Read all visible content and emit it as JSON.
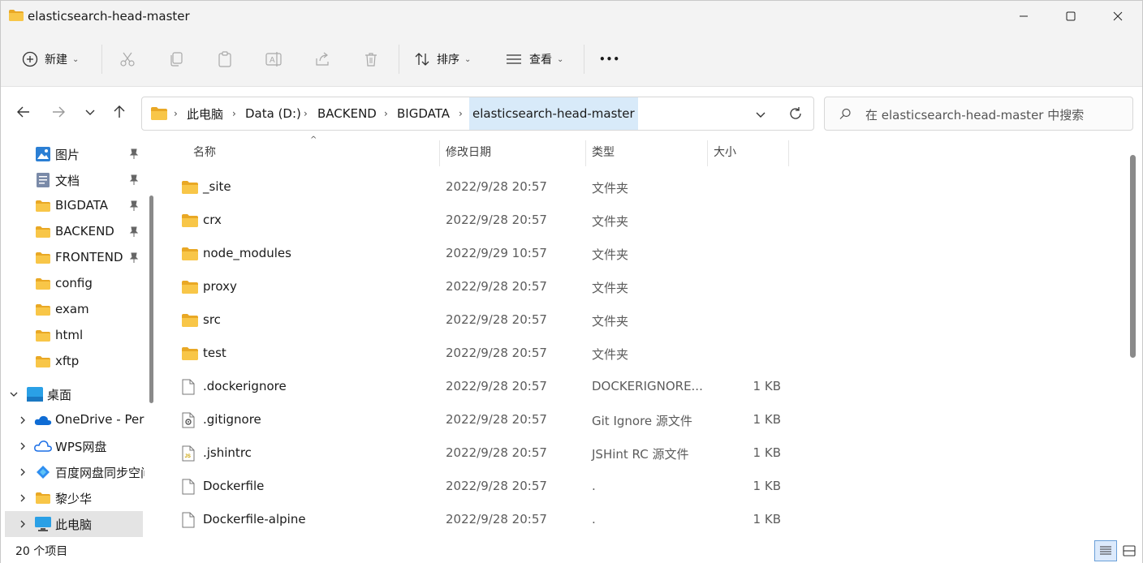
{
  "window": {
    "title": "elasticsearch-head-master",
    "minimize": "minimize",
    "maximize": "maximize",
    "close": "close"
  },
  "toolbar": {
    "new_label": "新建",
    "sort_label": "排序",
    "view_label": "查看",
    "more_label": "•••"
  },
  "address": {
    "crumbs": [
      "此电脑",
      "Data (D:)",
      "BACKEND",
      "BIGDATA",
      "elasticsearch-head-master"
    ]
  },
  "search": {
    "placeholder": "在 elasticsearch-head-master 中搜索"
  },
  "sidebar": {
    "items": [
      {
        "label": "图片",
        "icon": "pictures-icon",
        "pinned": true
      },
      {
        "label": "文档",
        "icon": "documents-icon",
        "pinned": true
      },
      {
        "label": "BIGDATA",
        "icon": "folder-icon",
        "pinned": true
      },
      {
        "label": "BACKEND",
        "icon": "folder-icon",
        "pinned": true
      },
      {
        "label": "FRONTEND",
        "icon": "folder-icon",
        "pinned": true
      },
      {
        "label": "config",
        "icon": "folder-icon",
        "pinned": false
      },
      {
        "label": "exam",
        "icon": "folder-icon",
        "pinned": false
      },
      {
        "label": "html",
        "icon": "folder-icon",
        "pinned": false
      },
      {
        "label": "xftp",
        "icon": "folder-icon",
        "pinned": false
      },
      {
        "label": "桌面",
        "icon": "desktop-icon",
        "expanded": true
      },
      {
        "label": "OneDrive - Pers",
        "icon": "onedrive-icon"
      },
      {
        "label": "WPS网盘",
        "icon": "wps-cloud-icon"
      },
      {
        "label": "百度网盘同步空间",
        "icon": "baidu-sync-icon"
      },
      {
        "label": "黎少华",
        "icon": "user-folder-icon"
      },
      {
        "label": "此电脑",
        "icon": "this-pc-icon",
        "selected": true
      }
    ]
  },
  "columns": {
    "name": "名称",
    "date": "修改日期",
    "type": "类型",
    "size": "大小"
  },
  "files": [
    {
      "name": "_site",
      "date": "2022/9/28 20:57",
      "type": "文件夹",
      "size": "",
      "icon": "folder-icon"
    },
    {
      "name": "crx",
      "date": "2022/9/28 20:57",
      "type": "文件夹",
      "size": "",
      "icon": "folder-icon"
    },
    {
      "name": "node_modules",
      "date": "2022/9/29 10:57",
      "type": "文件夹",
      "size": "",
      "icon": "folder-icon"
    },
    {
      "name": "proxy",
      "date": "2022/9/28 20:57",
      "type": "文件夹",
      "size": "",
      "icon": "folder-icon"
    },
    {
      "name": "src",
      "date": "2022/9/28 20:57",
      "type": "文件夹",
      "size": "",
      "icon": "folder-icon"
    },
    {
      "name": "test",
      "date": "2022/9/28 20:57",
      "type": "文件夹",
      "size": "",
      "icon": "folder-icon"
    },
    {
      "name": ".dockerignore",
      "date": "2022/9/28 20:57",
      "type": "DOCKERIGNORE...",
      "size": "1 KB",
      "icon": "file-icon"
    },
    {
      "name": ".gitignore",
      "date": "2022/9/28 20:57",
      "type": "Git Ignore 源文件",
      "size": "1 KB",
      "icon": "settings-file-icon"
    },
    {
      "name": ".jshintrc",
      "date": "2022/9/28 20:57",
      "type": "JSHint RC 源文件",
      "size": "1 KB",
      "icon": "js-file-icon"
    },
    {
      "name": "Dockerfile",
      "date": "2022/9/28 20:57",
      "type": ".",
      "size": "1 KB",
      "icon": "file-icon"
    },
    {
      "name": "Dockerfile-alpine",
      "date": "2022/9/28 20:57",
      "type": ".",
      "size": "1 KB",
      "icon": "file-icon"
    }
  ],
  "status": {
    "item_count": "20 个项目"
  },
  "colors": {
    "folder": "#f8c648",
    "folder_dark": "#e9a825",
    "selection": "#d8eaf9",
    "accent": "#0067c0"
  }
}
